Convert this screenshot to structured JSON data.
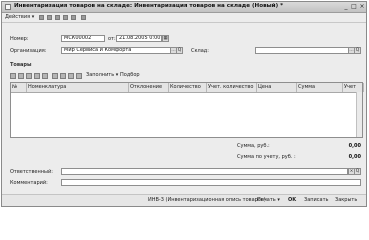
{
  "window": {
    "title": "Инвентаризация товаров на складе: Инвентаризация товаров на складе (Новый) *",
    "controls": [
      "_",
      "□",
      "×"
    ]
  },
  "toolbar": {
    "actions_label": "Действия",
    "arrow": "▾"
  },
  "form": {
    "number_label": "Номер:",
    "number_value": "МСК00002",
    "date_label": "от:",
    "date_value": "21.08.2005 0:00:00",
    "org_label": "Организация:",
    "org_value": "Мир Сервиса и Комфорта",
    "warehouse_label": "Склад:",
    "warehouse_value": ""
  },
  "goods": {
    "section_label": "Товары",
    "fill_label": "Заполнить",
    "select_label": "Подбор",
    "columns": [
      "№",
      "Номенклатура",
      "Отклонение",
      "Количество",
      "Учет. количество",
      "Цена",
      "Сумма",
      "Учет"
    ]
  },
  "totals": {
    "sum_label": "Сумма, руб.:",
    "sum_value": "0,00",
    "acc_label": "Сумма по учету, руб. :",
    "acc_value": "0,00"
  },
  "footer_fields": {
    "responsible_label": "Ответственный:",
    "responsible_value": "",
    "comment_label": "Комментарий:",
    "comment_value": ""
  },
  "status": {
    "form_ref": "ИНВ-3 (Инвентаризационная опись товаров)",
    "print_label": "Печать",
    "ok_label": "OK",
    "save_label": "Записать",
    "close_label": "Закрыть"
  }
}
